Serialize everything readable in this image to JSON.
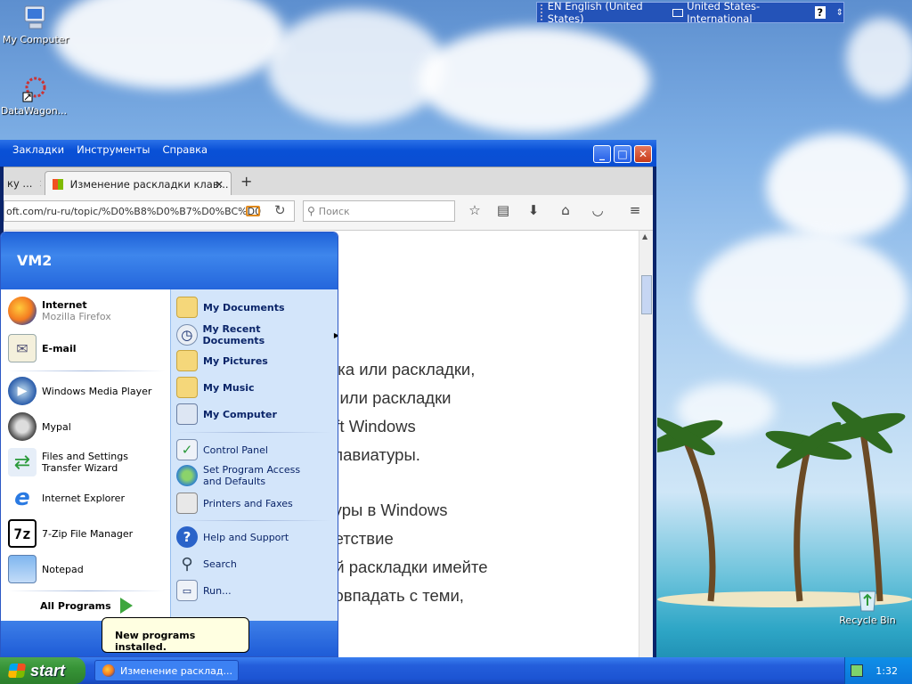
{
  "desktop": {
    "icons": [
      {
        "label": "My Computer"
      },
      {
        "label": "DataWagon..."
      },
      {
        "label": "Recycle Bin"
      }
    ]
  },
  "language_bar": {
    "language": "EN English (United States)",
    "layout": "United States-International",
    "help": "?"
  },
  "browser": {
    "menu": [
      "Закладки",
      "Инструменты",
      "Справка"
    ],
    "tabs": [
      {
        "label": "ку ..."
      },
      {
        "label": "Изменение раскладки клав..."
      }
    ],
    "new_tab": "+",
    "url": "oft.com/ru-ru/topic/%D0%B8%D0%B7%D0%BC%D0",
    "search_placeholder": "Поиск",
    "content_lines": [
      "ыка или раскладки,",
      "й или раскладки",
      "oft Windows",
      "клавиатуры.",
      "",
      "туры в Windows",
      "ветствие",
      "ой раскладки имейте",
      "совпадать с теми,"
    ]
  },
  "start_menu": {
    "user": "VM2",
    "pinned": [
      {
        "title": "Internet",
        "subtitle": "Mozilla Firefox"
      },
      {
        "title": "E-mail",
        "subtitle": ""
      }
    ],
    "recent": [
      "Windows Media Player",
      "Mypal",
      "Files and Settings Transfer Wizard",
      "Internet Explorer",
      "7-Zip File Manager",
      "Notepad"
    ],
    "all_programs": "All Programs",
    "right_items": [
      "My Documents",
      "My Recent Documents",
      "My Pictures",
      "My Music",
      "My Computer",
      "Control Panel",
      "Set Program Access and Defaults",
      "Printers and Faxes",
      "Help and Support",
      "Search",
      "Run..."
    ]
  },
  "balloon": {
    "text": "New programs installed."
  },
  "taskbar": {
    "start_label": "start",
    "task_label": "Изменение расклад...",
    "clock": "1:32"
  }
}
